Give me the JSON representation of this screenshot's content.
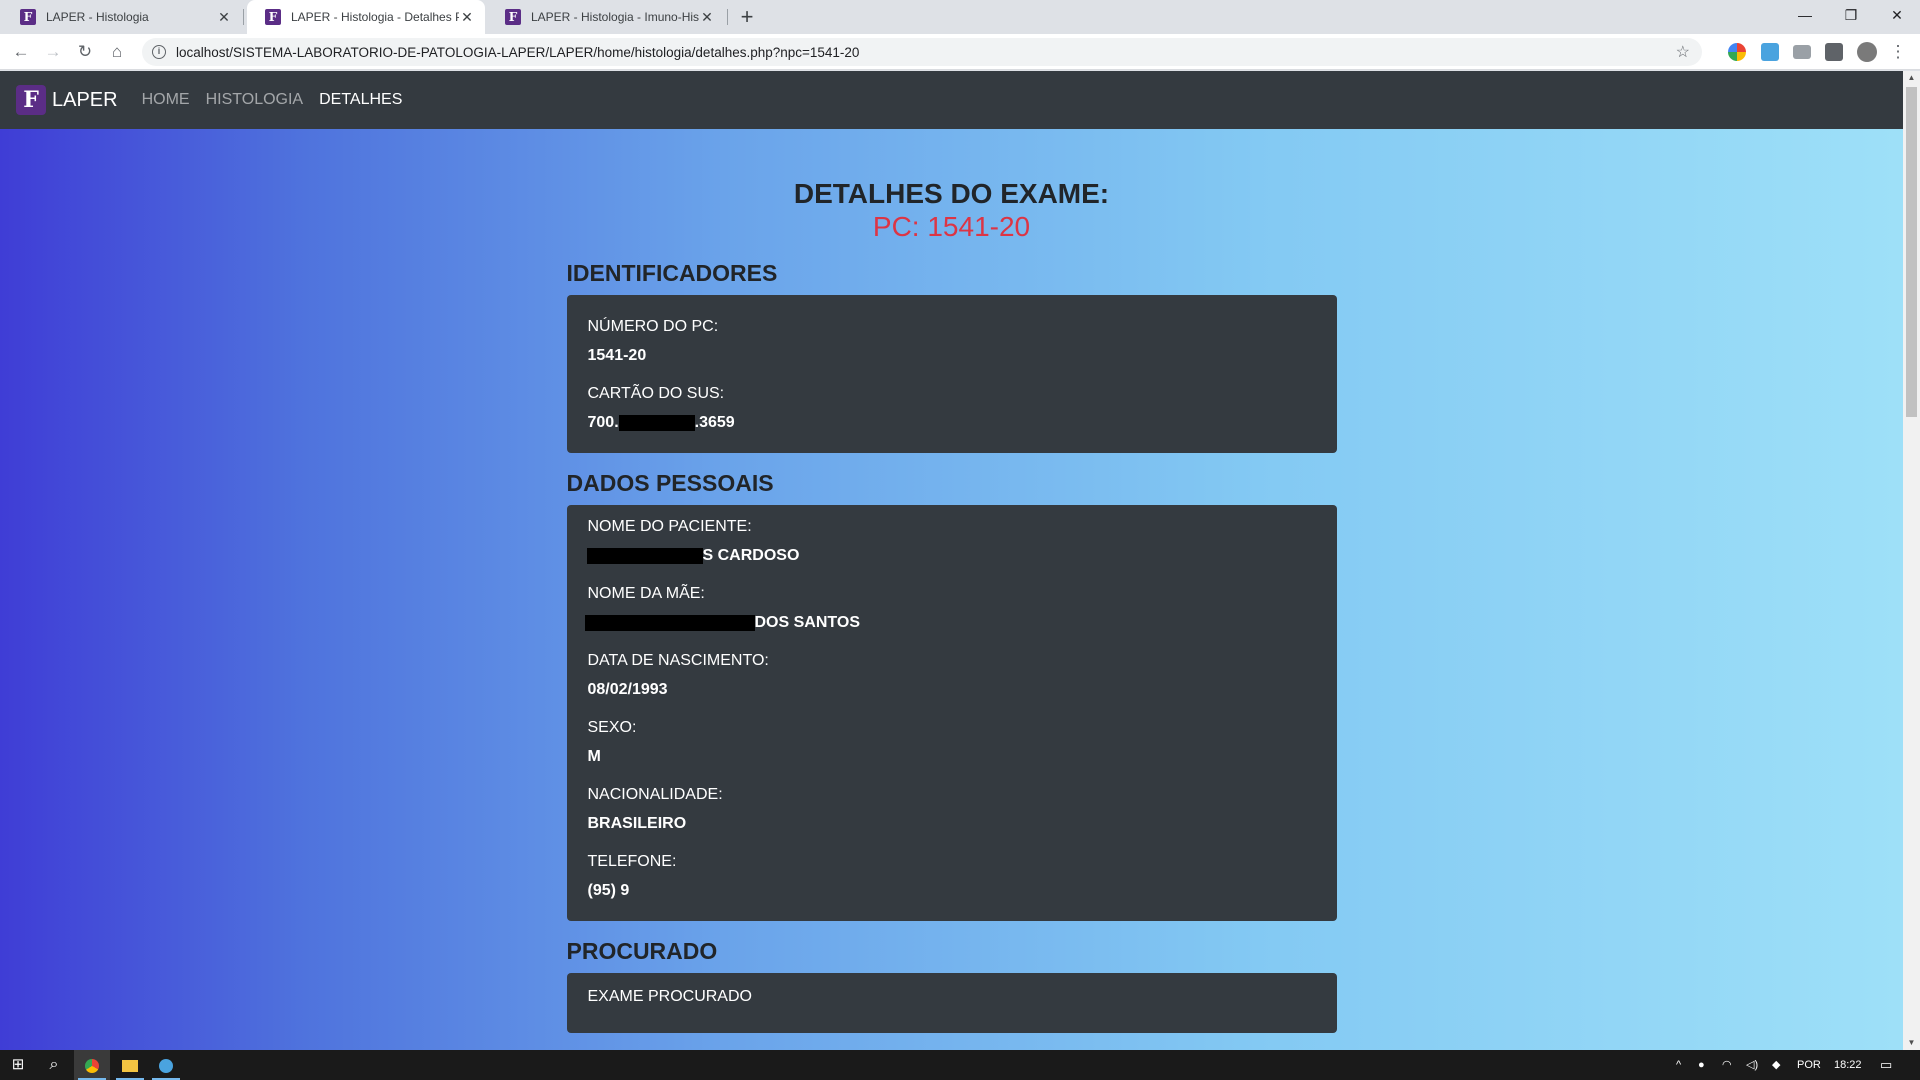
{
  "browser": {
    "tabs": [
      {
        "title": "LAPER - Histologia",
        "active": false
      },
      {
        "title": "LAPER - Histologia - Detalhes PC",
        "active": true
      },
      {
        "title": "LAPER - Histologia - Imuno-Histo",
        "active": false
      }
    ],
    "new_tab": "+",
    "url": "localhost/SISTEMA-LABORATORIO-DE-PATOLOGIA-LAPER/LAPER/home/histologia/detalhes.php?npc=1541-20",
    "favicon_letter": "F"
  },
  "navbar": {
    "brand": "LAPER",
    "logo_letter": "F",
    "links": [
      {
        "label": "HOME",
        "active": false
      },
      {
        "label": "HISTOLOGIA",
        "active": false
      },
      {
        "label": "DETALHES",
        "active": true
      }
    ]
  },
  "header": {
    "title": "DETALHES DO EXAME:",
    "subtitle": "PC: 1541-20"
  },
  "sections": {
    "identificadores": {
      "title": "IDENTIFICADORES",
      "fields": [
        {
          "label": "NÚMERO DO PC:",
          "value": "1541-20"
        },
        {
          "label": "CARTÃO DO SUS:",
          "value_prefix": "700.",
          "value_suffix": ".3659"
        }
      ]
    },
    "dados_pessoais": {
      "title": "DADOS PESSOAIS",
      "fields": [
        {
          "label": "NOME DO PACIENTE:",
          "value_suffix": "S CARDOSO"
        },
        {
          "label": "NOME DA MÃE:",
          "value_suffix": "DOS SANTOS"
        },
        {
          "label": "DATA DE NASCIMENTO:",
          "value": "08/02/1993"
        },
        {
          "label": "SEXO:",
          "value": "M"
        },
        {
          "label": "NACIONALIDADE:",
          "value": "BRASILEIRO"
        },
        {
          "label": "TELEFONE:",
          "value": "(95) 9"
        }
      ]
    },
    "procurado": {
      "title": "PROCURADO",
      "fields": [
        {
          "label": "EXAME PROCURADO"
        }
      ]
    }
  },
  "taskbar": {
    "language": "POR",
    "time": "18:22"
  },
  "colors": {
    "navbar_bg": "#343a40",
    "card_bg": "#343a40",
    "subtitle_red": "#dc3545",
    "brand_purple": "#5b2d86"
  }
}
